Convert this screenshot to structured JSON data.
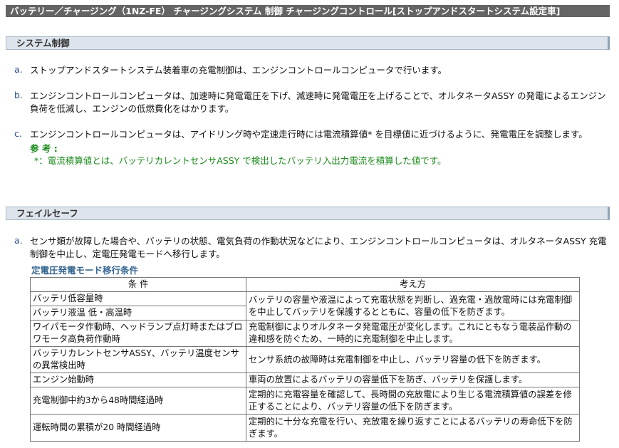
{
  "title": "バッテリー／チャージング（1NZ-FE） チャージングシステム 制御 チャージングコントロール[ストップアンドスタートシステム設定車]",
  "section1": {
    "heading": "システム制御",
    "items": [
      {
        "mark": "a.",
        "text": "ストップアンドスタートシステム装着車の充電制御は、エンジンコントロールコンピュータで行います。"
      },
      {
        "mark": "b.",
        "text": "エンジンコントロールコンピュータは、加速時に発電電圧を下げ、減速時に発電電圧を上げることで、オルタネータASSY の発電によるエンジン負荷を低減し、エンジンの低燃費化をはかります。"
      },
      {
        "mark": "c.",
        "text": "エンジンコントロールコンピュータは、アイドリング時や定速走行時には電流積算値* を目標値に近づけるように、発電電圧を調整します。"
      }
    ],
    "note_title": "参 考 :",
    "note_text": "*：電流積算値とは、バッテリカレントセンサASSY で検出したバッテリ入出力電流を積算した値です。"
  },
  "section2": {
    "heading": "フェイルセーフ",
    "item": {
      "mark": "a.",
      "text": "センサ類が故障した場合や、バッテリの状態、電気負荷の作動状況などにより、エンジンコントロールコンピュータは、オルタネータASSY 充電制御を中止し、定電圧発電モードへ移行します。"
    },
    "table_title": "定電圧発電モード移行条件",
    "table": {
      "headers": [
        "条 件",
        "考え方"
      ],
      "rows": [
        {
          "cond": "バッテリ低容量時",
          "reason": "バッテリの容量や液温によって充電状態を判断し、過充電・過放電時には充電制御を中止してバッテリを保護するとともに、容量の低下を防ぎます。"
        },
        {
          "cond": "バッテリ液温 低・高温時",
          "reason": ""
        },
        {
          "cond": "ワイパモータ作動時、ヘッドランプ点灯時またはブロワモータ高負荷作動時",
          "reason": "充電制御によりオルタネータ発電電圧が変化します。これにともなう電装品作動の違和感を防ぐため、一時的に充電制御を中止します。"
        },
        {
          "cond": "バッテリカレントセンサASSY、バッテリ温度センサの異常検出時",
          "reason": "センサ系統の故障時は充電制御を中止し、バッテリ容量の低下を防ぎます。"
        },
        {
          "cond": "エンジン始動時",
          "reason": "車両の放置によるバッテリの容量低下を防ぎ、バッテリを保護します。"
        },
        {
          "cond": "充電制御中約3から48時間経過時",
          "reason": "定期的に充電容量を確認して、長時間の充放電により生じる電流積算値の誤差を修正することにより、バッテリ容量の低下を防ぎます。"
        },
        {
          "cond": "運転時間の累積が20 時間経過時",
          "reason": "定期的に十分な充電を行い、充放電を繰り返すことによるバッテリの寿命低下を防ぎます。"
        }
      ]
    }
  }
}
